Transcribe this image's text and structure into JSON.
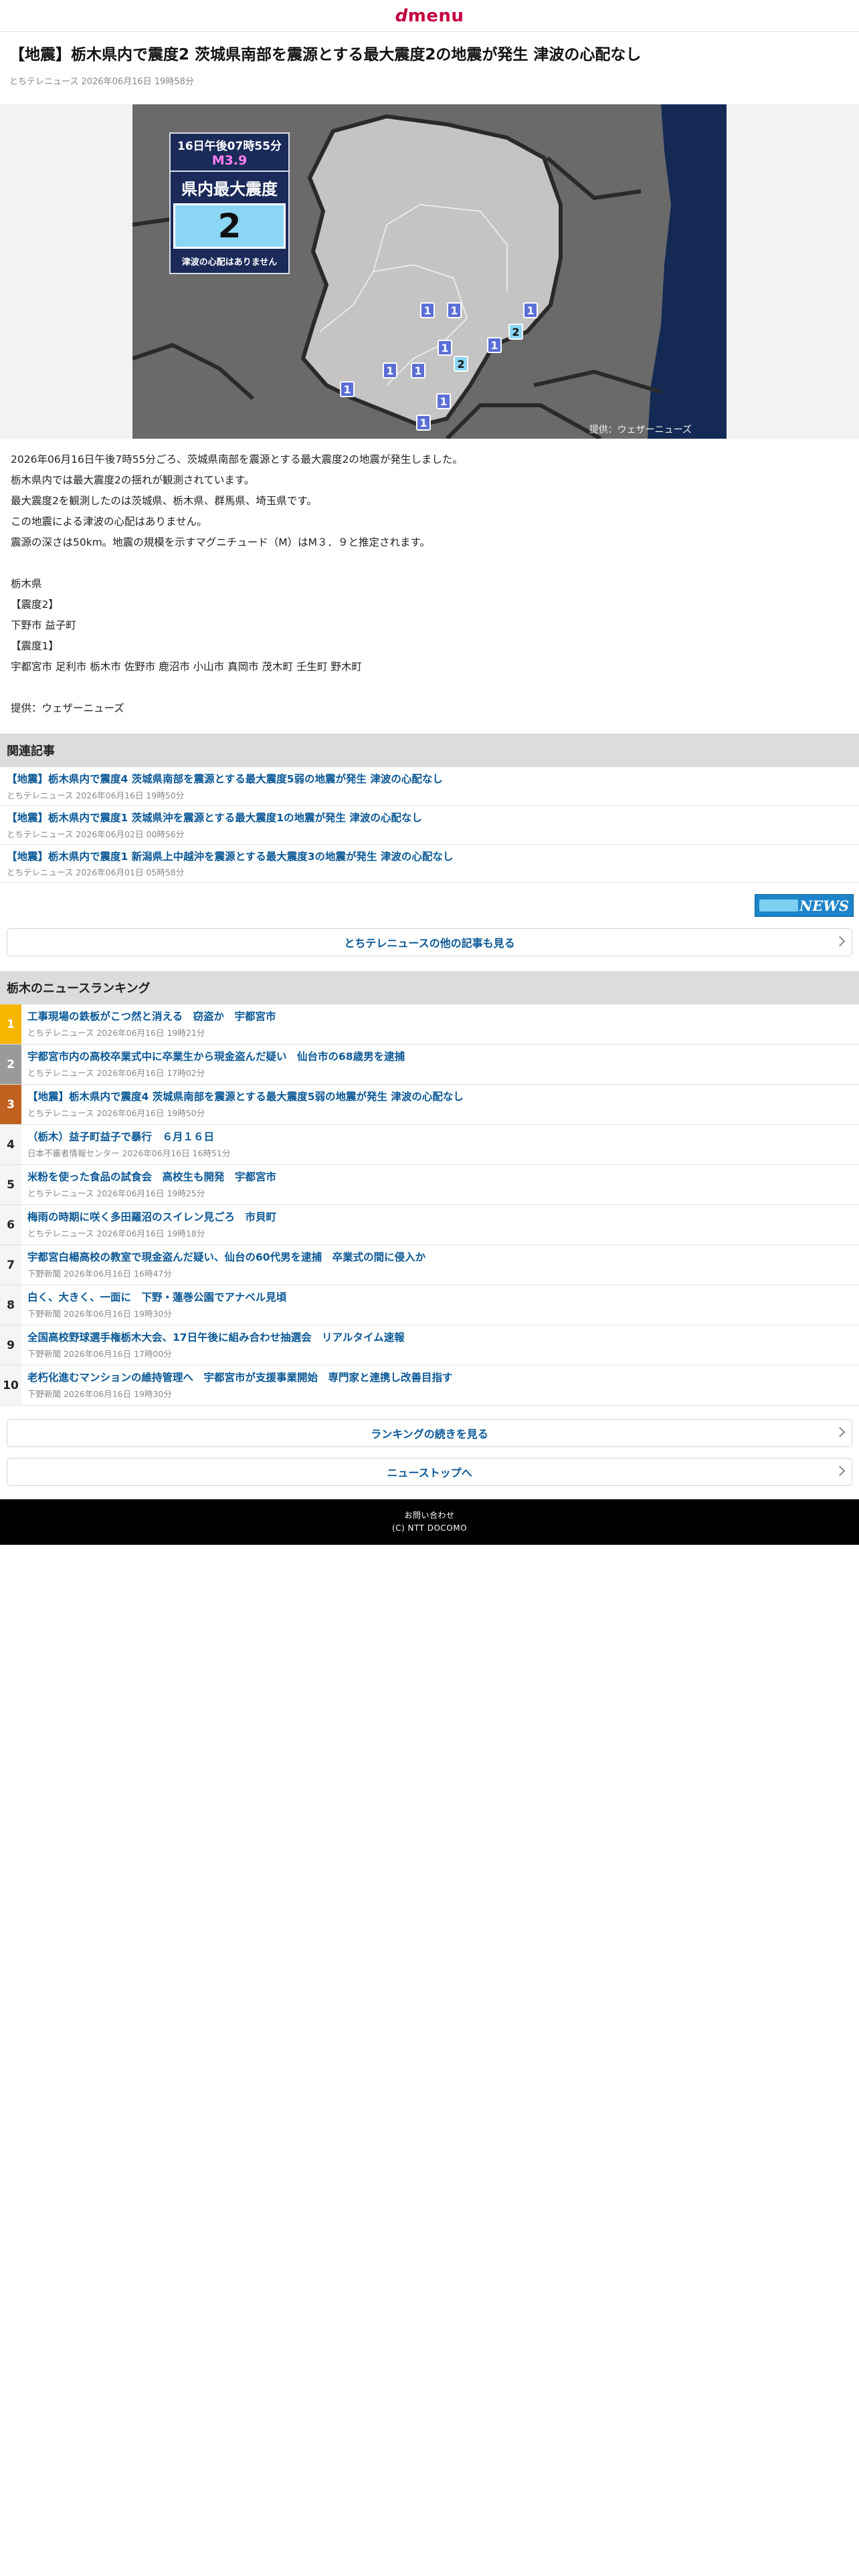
{
  "header": {
    "logo_d": "d",
    "logo_rest": "menu"
  },
  "article": {
    "title": "【地震】栃木県内で震度2 茨城県南部を震源とする最大震度2の地震が発生 津波の心配なし",
    "meta": "とちテレニュース 2026年06月16日 19時58分",
    "figure": {
      "time": "16日午後07時55分",
      "magnitude": "M3.9",
      "label": "県内最大震度",
      "scale": "2",
      "tsunami": "津波の心配はありません",
      "credit": "提供：ウェザーニューズ",
      "markers": [
        "1",
        "1",
        "1",
        "2",
        "1",
        "1",
        "2",
        "1",
        "1",
        "1",
        "1",
        "1"
      ]
    },
    "body": [
      "2026年06月16日午後7時55分ごろ、茨城県南部を震源とする最大震度2の地震が発生しました。",
      "栃木県内では最大震度2の揺れが観測されています。",
      "最大震度2を観測したのは茨城県、栃木県、群馬県、埼玉県です。",
      "この地震による津波の心配はありません。",
      "震源の深さは50km。地震の規模を示すマグニチュード（M）はM３．９と推定されます。",
      "",
      "栃木県",
      "【震度2】",
      "下野市 益子町",
      "【震度1】",
      "宇都宮市 足利市 栃木市 佐野市 鹿沼市 小山市 真岡市 茂木町 壬生町 野木町",
      "",
      "提供：ウェザーニューズ"
    ]
  },
  "related": {
    "heading": "関連記事",
    "items": [
      {
        "title": "【地震】栃木県内で震度4 茨城県南部を震源とする最大震度5弱の地震が発生 津波の心配なし",
        "meta": "とちテレニュース 2026年06月16日 19時50分"
      },
      {
        "title": "【地震】栃木県内で震度1 茨城県沖を震源とする最大震度1の地震が発生 津波の心配なし",
        "meta": "とちテレニュース 2026年06月02日 00時56分"
      },
      {
        "title": "【地震】栃木県内で震度1 新潟県上中越沖を震源とする最大震度3の地震が発生 津波の心配なし",
        "meta": "とちテレニュース 2026年06月01日 05時58分"
      }
    ],
    "news_logo": "NEWS",
    "more_label": "とちテレニュースの他の記事も見る"
  },
  "ranking": {
    "heading": "栃木のニュースランキング",
    "items": [
      {
        "rank": "1",
        "title": "工事現場の鉄板がこつ然と消える　窃盗か　宇都宮市",
        "meta": "とちテレニュース 2026年06月16日 19時21分"
      },
      {
        "rank": "2",
        "title": "宇都宮市内の高校卒業式中に卒業生から現金盗んだ疑い　仙台市の68歳男を逮捕",
        "meta": "とちテレニュース 2026年06月16日 17時02分"
      },
      {
        "rank": "3",
        "title": "【地震】栃木県内で震度4 茨城県南部を震源とする最大震度5弱の地震が発生 津波の心配なし",
        "meta": "とちテレニュース 2026年06月16日 19時50分"
      },
      {
        "rank": "4",
        "title": "（栃木）益子町益子で暴行　６月１６日",
        "meta": "日本不審者情報センター 2026年06月16日 16時51分"
      },
      {
        "rank": "5",
        "title": "米粉を使った食品の試食会　高校生も開発　宇都宮市",
        "meta": "とちテレニュース 2026年06月16日 19時25分"
      },
      {
        "rank": "6",
        "title": "梅雨の時期に咲く多田羅沼のスイレン見ごろ　市貝町",
        "meta": "とちテレニュース 2026年06月16日 19時18分"
      },
      {
        "rank": "7",
        "title": "宇都宮白楊高校の教室で現金盗んだ疑い、仙台の60代男を逮捕　卒業式の間に侵入か",
        "meta": "下野新聞 2026年06月16日 16時47分"
      },
      {
        "rank": "8",
        "title": "白く、大きく、一面に　下野・蓮巻公園でアナベル見頃",
        "meta": "下野新聞 2026年06月16日 19時30分"
      },
      {
        "rank": "9",
        "title": "全国高校野球選手権栃木大会、17日午後に組み合わせ抽選会　リアルタイム速報",
        "meta": "下野新聞 2026年06月16日 17時00分"
      },
      {
        "rank": "10",
        "title": "老朽化進むマンションの維持管理へ　宇都宮市が支援事業開始　専門家と連携し改善目指す",
        "meta": "下野新聞 2026年06月16日 19時30分"
      }
    ],
    "more_label": "ランキングの続きを見る",
    "top_label": "ニューストップへ"
  },
  "footer": {
    "contact": "お問い合わせ",
    "copyright": "(C) NTT DOCOMO"
  },
  "colors": {
    "brand": "#c4003e",
    "link": "#0a5896",
    "rank1": "#f7b500",
    "rank2": "#9a9a9a",
    "rank3": "#c0621f"
  }
}
